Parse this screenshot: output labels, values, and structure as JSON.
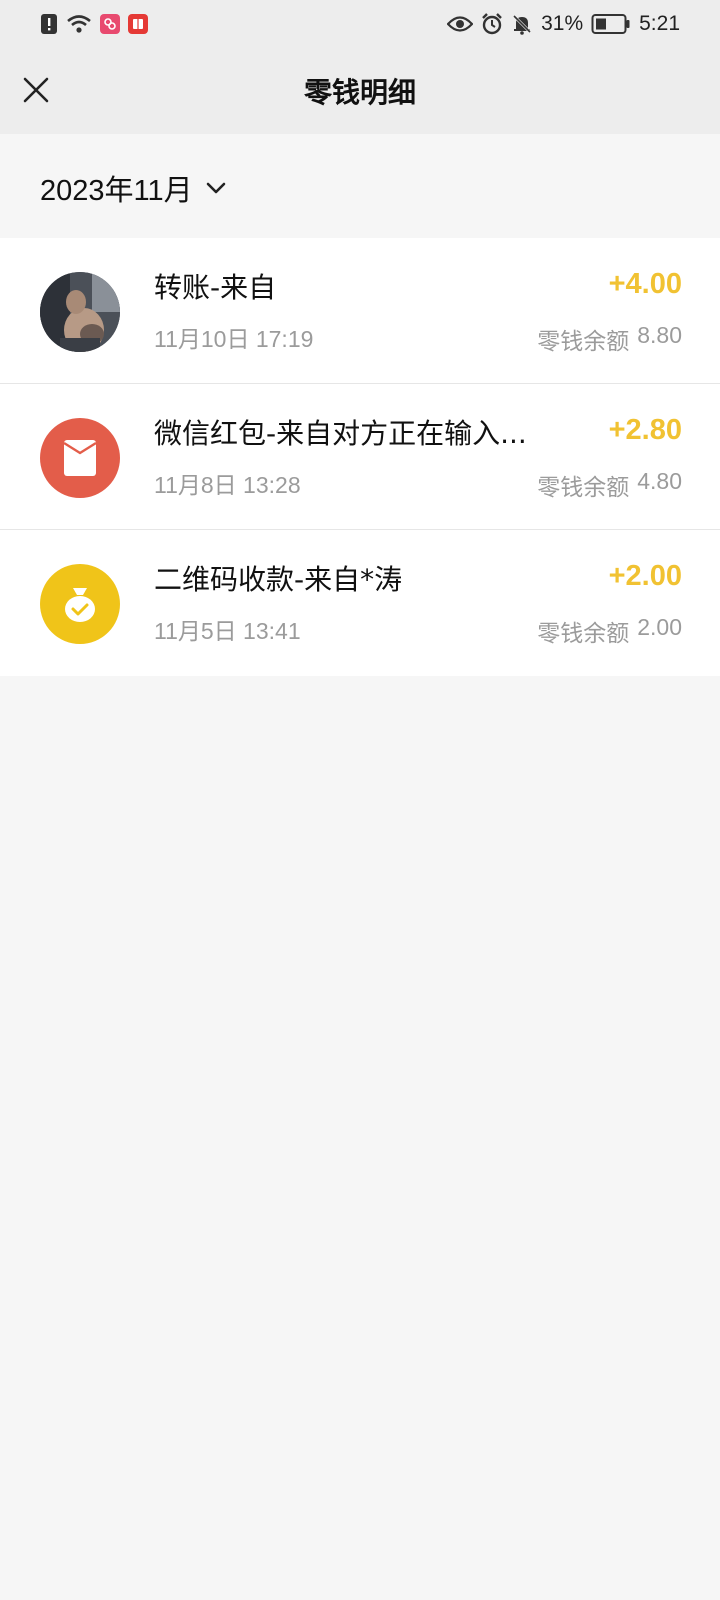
{
  "status_bar": {
    "battery_percent": "31%",
    "time": "5:21"
  },
  "header": {
    "title": "零钱明细"
  },
  "filter": {
    "month": "2023年11月"
  },
  "transactions": [
    {
      "title": "转账-来自",
      "time": "11月10日 17:19",
      "amount": "+4.00",
      "balance_label": "零钱余额",
      "balance": "8.80",
      "icon": "user-photo-avatar"
    },
    {
      "title": "微信红包-来自对方正在输入...",
      "time": "11月8日 13:28",
      "amount": "+2.80",
      "balance_label": "零钱余额",
      "balance": "4.80",
      "icon": "red-packet-icon"
    },
    {
      "title": "二维码收款-来自*涛",
      "time": "11月5日 13:41",
      "amount": "+2.00",
      "balance_label": "零钱余额",
      "balance": "2.00",
      "icon": "money-bag-icon"
    }
  ],
  "colors": {
    "amount": "#f1c232",
    "red_packet": "#e35d4a",
    "money_bag": "#f0c419",
    "header_bg": "#ededed",
    "page_bg": "#f6f6f6"
  }
}
